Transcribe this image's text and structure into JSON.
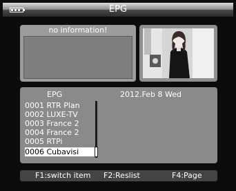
{
  "title_bar": {
    "title": "EPG",
    "battery_icon": "battery-icon"
  },
  "info_panel": {
    "message": "no information!"
  },
  "preview": {
    "description_icon": "video-preview-icon"
  },
  "epg_list": {
    "header_label": "EPG",
    "date": "2012.Feb 8   Wed",
    "channels": [
      {
        "label": "0001 RTR Plan"
      },
      {
        "label": "0002 LUXE-TV"
      },
      {
        "label": "0003 France 2"
      },
      {
        "label": "0004 France 2"
      },
      {
        "label": "0005 RTPi"
      },
      {
        "label": "0006 Cubavisi"
      }
    ],
    "selected_index": 5
  },
  "footer": {
    "f1": "F1:switch item",
    "f2": "F2:Reslist",
    "f4": "F4:Page"
  },
  "colors": {
    "background": "#0c0c0c",
    "panel": "#8a8a8a",
    "selection": "#ffffff",
    "text": "#ffffff"
  }
}
